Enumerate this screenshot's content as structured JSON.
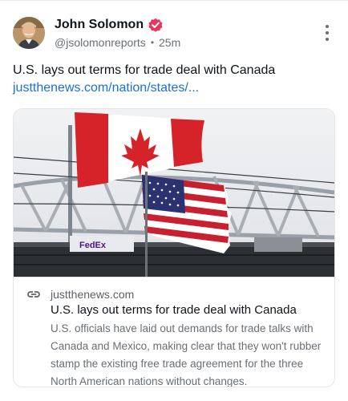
{
  "author": {
    "name": "John Solomon",
    "handle": "@jsolomonreports",
    "time": "25m",
    "separator": "•"
  },
  "post": {
    "text": "U.S. lays out terms for trade deal with Canada",
    "link_text": "justthenews.com/nation/states/..."
  },
  "card": {
    "domain": "justthenews.com",
    "title": "U.S. lays out terms for trade deal with Canada",
    "description": "U.S. officials have laid out demands for trade talks with Canada and Mexico, making clear that they won't rubber stamp the existing free trade agreement for the three North American nations without changes.",
    "image_alt": "Canadian and American flags flying over a bridge",
    "truck_text": "FedEx"
  },
  "colors": {
    "link": "#1d6fd6",
    "verified_badge": "#e8365d",
    "muted_text": "#6a6f76"
  },
  "icons": {
    "verified": "verified-badge-icon",
    "more": "more-options-icon",
    "link": "link-icon"
  }
}
